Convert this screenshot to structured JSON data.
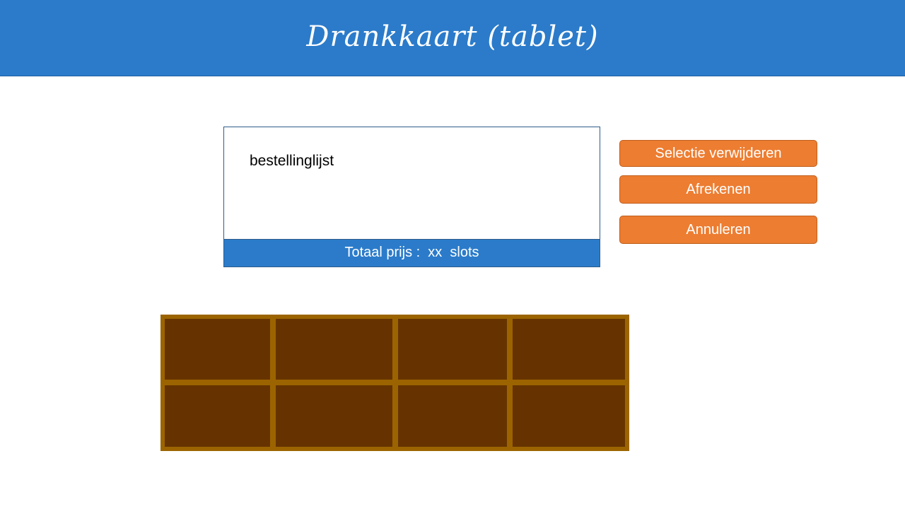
{
  "header": {
    "title": "Drankkaart (tablet)"
  },
  "order_panel": {
    "list_label": "bestellinglijst",
    "total_text": "Totaal prijs :  xx  slots"
  },
  "actions": {
    "remove_selection": "Selectie verwijderen",
    "checkout": "Afrekenen",
    "cancel": "Annuleren"
  },
  "drink_grid": {
    "rows": 2,
    "columns": 4
  },
  "colors": {
    "header_bg": "#2b7bca",
    "button_bg": "#ed7d31",
    "grid_frame": "#9c6400",
    "grid_cell": "#663300"
  }
}
